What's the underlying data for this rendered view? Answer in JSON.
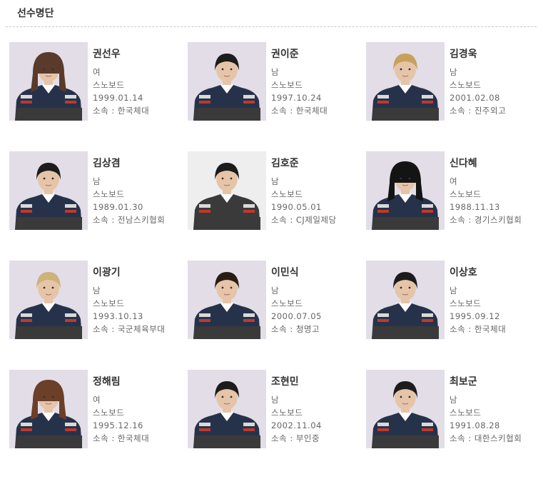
{
  "page": {
    "title": "선수명단"
  },
  "players": [
    {
      "name": "권선우",
      "gender": "여",
      "sport": "스노보드",
      "birth": "1999.01.14",
      "affiliation": "소속 : 한국체대",
      "hair": "#5a3a2a",
      "long_hair": true
    },
    {
      "name": "권이준",
      "gender": "남",
      "sport": "스노보드",
      "birth": "1997.10.24",
      "affiliation": "소속 : 한국체대",
      "hair": "#1c1c1c",
      "long_hair": false
    },
    {
      "name": "김경욱",
      "gender": "남",
      "sport": "스노보드",
      "birth": "2001.02.08",
      "affiliation": "소속 : 진주외고",
      "hair": "#c7a15c",
      "long_hair": false
    },
    {
      "name": "김상겸",
      "gender": "남",
      "sport": "스노보드",
      "birth": "1989.01.30",
      "affiliation": "소속 : 전남스키협회",
      "hair": "#1c1c1c",
      "long_hair": false
    },
    {
      "name": "김호준",
      "gender": "남",
      "sport": "스노보드",
      "birth": "1990.05.01",
      "affiliation": "소속 : CJ제일제당",
      "hair": "#1c1c1c",
      "long_hair": false,
      "alt": true
    },
    {
      "name": "신다혜",
      "gender": "여",
      "sport": "스노보드",
      "birth": "1988.11.13",
      "affiliation": "소속 : 경기스키협회",
      "hair": "#141414",
      "long_hair": true
    },
    {
      "name": "이광기",
      "gender": "남",
      "sport": "스노보드",
      "birth": "1993.10.13",
      "affiliation": "소속 : 국군체육부대",
      "hair": "#cdb27a",
      "long_hair": false
    },
    {
      "name": "이민식",
      "gender": "남",
      "sport": "스노보드",
      "birth": "2000.07.05",
      "affiliation": "소속 : 청명고",
      "hair": "#2a1c14",
      "long_hair": false
    },
    {
      "name": "이상호",
      "gender": "남",
      "sport": "스노보드",
      "birth": "1995.09.12",
      "affiliation": "소속 : 한국체대",
      "hair": "#1c1c1c",
      "long_hair": false
    },
    {
      "name": "정해림",
      "gender": "여",
      "sport": "스노보드",
      "birth": "1995.12.16",
      "affiliation": "소속 : 한국체대",
      "hair": "#6b3f28",
      "long_hair": true
    },
    {
      "name": "조현민",
      "gender": "남",
      "sport": "스노보드",
      "birth": "2002.11.04",
      "affiliation": "소속 : 부인중",
      "hair": "#1c1c1c",
      "long_hair": false
    },
    {
      "name": "최보군",
      "gender": "남",
      "sport": "스노보드",
      "birth": "1991.08.28",
      "affiliation": "소속 : 대한스키협회",
      "hair": "#1c1c1c",
      "long_hair": false
    }
  ],
  "colors": {
    "jacket": "#26324a",
    "jacket_lower": "#3a3a3a",
    "skin": "#e6c4a8",
    "background": "#e2dde6"
  }
}
